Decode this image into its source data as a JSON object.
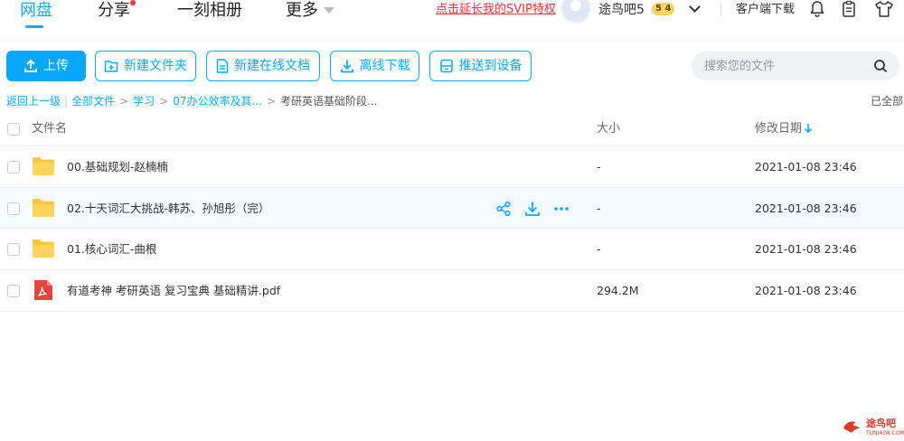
{
  "nav": {
    "tabs": [
      {
        "label": "网盘",
        "active": true
      },
      {
        "label": "分享",
        "has_dot": true
      },
      {
        "label": "一刻相册"
      },
      {
        "label": "更多"
      }
    ]
  },
  "header": {
    "svip_link": "点击延长我的SVIP特权",
    "username": "途鸟吧5",
    "level_badge": "5 4",
    "client_download": "客户端下载",
    "icons": [
      "bell-icon",
      "clipboard-icon",
      "shirt-icon"
    ]
  },
  "toolbar": {
    "upload": "上传",
    "new_folder": "新建文件夹",
    "new_online_doc": "新建在线文档",
    "offline_download": "离线下载",
    "push_to_device": "推送到设备",
    "search_placeholder": "搜索您的文件"
  },
  "breadcrumb": {
    "back": "返回上一级",
    "items": [
      "全部文件",
      "学习",
      "07办公效率及其...",
      "考研英语基础阶段..."
    ],
    "loaded_status": "已全部"
  },
  "table": {
    "columns": {
      "name": "文件名",
      "size": "大小",
      "date": "修改日期"
    },
    "rows": [
      {
        "type": "folder",
        "name": "00.基础规划-赵楠楠",
        "size": "-",
        "date": "2021-01-08 23:46"
      },
      {
        "type": "folder",
        "name": "02.十天词汇大挑战-韩苏、孙旭彤（完）",
        "size": "-",
        "date": "2021-01-08 23:46",
        "hovered": true
      },
      {
        "type": "folder",
        "name": "01.核心词汇-曲根",
        "size": "-",
        "date": "2021-01-08 23:46"
      },
      {
        "type": "pdf",
        "name": "有道考神 考研英语 复习宝典 基础精讲.pdf",
        "size": "294.2M",
        "date": "2021-01-08 23:46"
      }
    ]
  },
  "watermark": {
    "text": "途鸟吧",
    "sub": "TUNIAO8.COM"
  },
  "colors": {
    "accent": "#09AAFF",
    "svip": "#FF3333",
    "folder": "#FFC73D",
    "pdf": "#E5453A"
  }
}
